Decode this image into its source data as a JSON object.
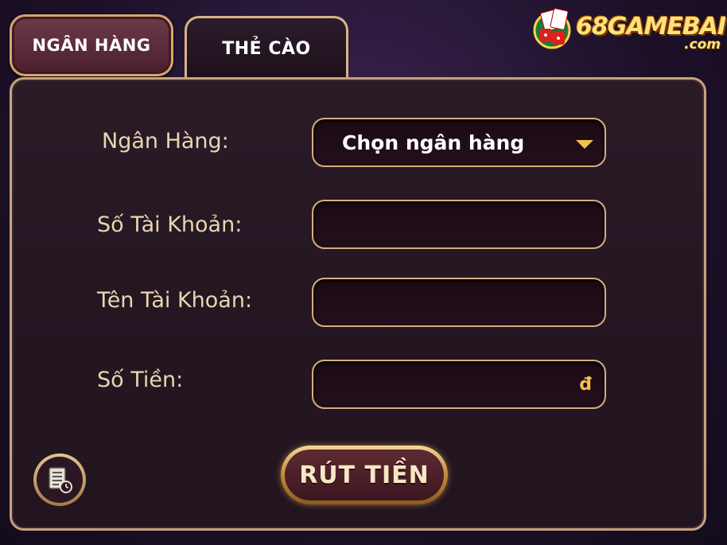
{
  "tabs": {
    "bank": "NGÂN HÀNG",
    "card": "THẺ CÀO",
    "active": "card"
  },
  "logo": {
    "main": "68GAMEBAI",
    "sub": ".com",
    "icon": "dice-cards-icon"
  },
  "form": {
    "bank_label": "Ngân Hàng:",
    "bank_select_value": "Chọn ngân hàng",
    "account_number_label": "Số Tài Khoản:",
    "account_number_value": "",
    "account_name_label": "Tên Tài Khoản:",
    "account_name_value": "",
    "amount_label": "Số Tiền:",
    "amount_value": "",
    "currency_symbol": "đ"
  },
  "actions": {
    "withdraw_label": "RÚT TIỀN",
    "history_icon": "history-icon"
  },
  "colors": {
    "gold": "#d6ae7f",
    "accent_yellow": "#f3c04a",
    "label_text": "#e8d6b0",
    "panel_bg": "#261722"
  }
}
